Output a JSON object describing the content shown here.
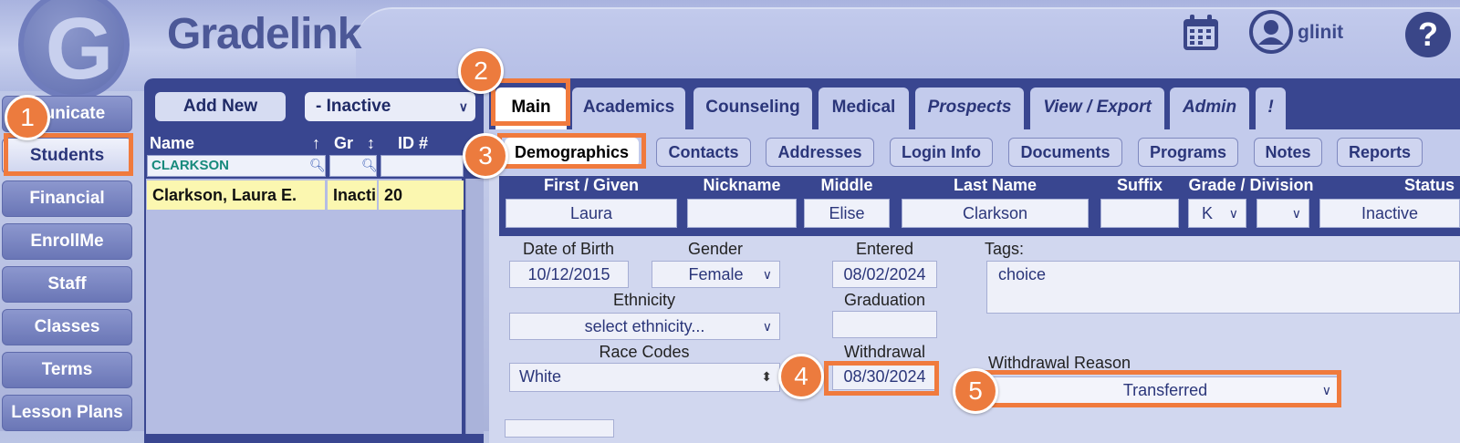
{
  "header": {
    "brand": "Gradelink",
    "username": "glinit",
    "help": "?"
  },
  "nav": [
    "Communicate",
    "Students",
    "Financial",
    "EnrollMe",
    "Staff",
    "Classes",
    "Terms",
    "Lesson Plans"
  ],
  "nav_visible": [
    "municate",
    "Students",
    "Financial",
    "EnrollMe",
    "Staff",
    "Classes",
    "Terms",
    "Lesson Plans"
  ],
  "student_panel": {
    "add_new": "Add New",
    "filter": "- Inactive",
    "columns": {
      "name": "Name",
      "name_sort": "↑",
      "grade": "Gr",
      "grade_sort": "↕",
      "id": "ID #"
    },
    "name_filter": "CLARKSON",
    "rows": [
      {
        "name": "Clarkson, Laura E.",
        "grade": "Inacti",
        "id": "20"
      }
    ]
  },
  "tabs": [
    "Main",
    "Academics",
    "Counseling",
    "Medical",
    "Prospects",
    "View / Export",
    "Admin",
    "!"
  ],
  "subtabs": [
    "Demographics",
    "Contacts",
    "Addresses",
    "Login Info",
    "Documents",
    "Programs",
    "Notes",
    "Reports"
  ],
  "name_headers": {
    "first": "First / Given",
    "nickname": "Nickname",
    "middle": "Middle",
    "last": "Last Name",
    "suffix": "Suffix",
    "grade_div": "Grade / Division",
    "status": "Status"
  },
  "name_values": {
    "first": "Laura",
    "nickname": "",
    "middle": "Elise",
    "last": "Clarkson",
    "suffix": "",
    "grade": "K",
    "division": "",
    "status": "Inactive"
  },
  "fields": {
    "dob_label": "Date of Birth",
    "dob": "10/12/2015",
    "gender_label": "Gender",
    "gender": "Female",
    "entered_label": "Entered",
    "entered": "08/02/2024",
    "tags_label": "Tags:",
    "tags": "choice",
    "ethnicity_label": "Ethnicity",
    "ethnicity": "select ethnicity...",
    "graduation_label": "Graduation",
    "graduation": "",
    "race_label": "Race Codes",
    "race": "White",
    "withdrawal_label": "Withdrawal",
    "withdrawal": "08/30/2024",
    "withdrawal_reason_label": "Withdrawal Reason",
    "withdrawal_reason": "Transferred"
  },
  "callouts": [
    "1",
    "2",
    "3",
    "4",
    "5"
  ],
  "colors": {
    "accent": "#ec7b3e",
    "navy": "#394690",
    "highlight_row": "#fbf7b0"
  }
}
